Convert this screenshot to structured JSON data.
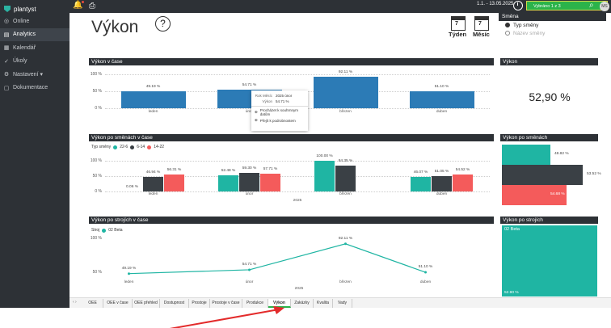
{
  "app": {
    "name": "plantyst"
  },
  "sidebar": {
    "items": [
      {
        "label": "Online",
        "icon": "globe-icon",
        "glyph": "◎",
        "active": false
      },
      {
        "label": "Analytics",
        "icon": "bar-chart-icon",
        "glyph": "▤",
        "active": true
      },
      {
        "label": "Kalendář",
        "icon": "calendar-icon",
        "glyph": "▦",
        "active": false
      },
      {
        "label": "Úkoly",
        "icon": "check-icon",
        "glyph": "✓",
        "active": false
      },
      {
        "label": "Nastavení ▾",
        "icon": "gear-icon",
        "glyph": "⚙",
        "active": false
      },
      {
        "label": "Dokumentace",
        "icon": "document-icon",
        "glyph": "▢",
        "active": false
      }
    ]
  },
  "topbar": {
    "date_range": "1.1. - 13.05.2025",
    "selection": "Vybráno 1 z 3",
    "clear": "✕",
    "avatar": "MS"
  },
  "header": {
    "title": "Výkon",
    "help": "?",
    "week": "Týden",
    "week_num": "7",
    "month": "Měsíc",
    "month_num": "7"
  },
  "shift": {
    "title": "Směna",
    "options": [
      "Typ směny",
      "Název směny"
    ],
    "selected": 0
  },
  "panels": {
    "time": "Výkon v čase",
    "kpi": "Výkon",
    "shifts": "Výkon po směnách v čase",
    "shifts_right": "Výkon po směnách",
    "machines": "Výkon po strojích v čase",
    "machines_right": "Výkon po strojích"
  },
  "kpi_value": "52,90 %",
  "axis_labels": {
    "p100": "100 %",
    "p50": "50 %",
    "p0": "0 %",
    "year": "2025"
  },
  "chart_time": {
    "type": "bar",
    "categories": [
      "leden",
      "únor",
      "březen",
      "duben"
    ],
    "values": [
      49.19,
      54.71,
      92.11,
      51.1
    ],
    "labels": [
      "49.19 %",
      "54.71 %",
      "92.11 %",
      "51.10 %"
    ],
    "ylim": [
      0,
      100
    ],
    "color": "#2c7bb6"
  },
  "tooltip": {
    "k1": "Rok Měsíc",
    "v1": "2025 únor",
    "k2": "Výkon",
    "v2": "54.71 %",
    "a1": "Procházet k souhrnnym datům",
    "a2": "Přejít k podrobnostem"
  },
  "legend_shifts": {
    "title": "Typ směny",
    "items": [
      {
        "label": "22-6",
        "color": "#1fb5a3"
      },
      {
        "label": "6-14",
        "color": "#3a4045"
      },
      {
        "label": "14-22",
        "color": "#f45b5b"
      }
    ]
  },
  "chart_shifts": {
    "type": "bar",
    "categories": [
      "leden",
      "únor",
      "březen",
      "duben"
    ],
    "series": [
      {
        "name": "22-6",
        "color": "#1fb5a3",
        "values": [
          0.06,
          52.48,
          100.0,
          46.07
        ],
        "labels": [
          "0.06 %",
          "52.48 %",
          "100.00 %",
          "46.07 %"
        ]
      },
      {
        "name": "6-14",
        "color": "#3a4045",
        "values": [
          46.94,
          59.3,
          84.35,
          51.05
        ],
        "labels": [
          "46.94 %",
          "59.30 %",
          "84.35 %",
          "51.05 %"
        ]
      },
      {
        "name": "14-22",
        "color": "#f45b5b",
        "values": [
          56.31,
          57.71,
          null,
          54.52
        ],
        "labels": [
          "56.31 %",
          "57.71 %",
          "",
          "54.52 %"
        ]
      }
    ],
    "ylim": [
      0,
      100
    ]
  },
  "shifts_right": [
    {
      "label": "48.82 %",
      "color": "#1fb5a3"
    },
    {
      "label": "53.52 %",
      "color": "#3a4045"
    },
    {
      "label": "54.68 %",
      "color": "#f45b5b"
    }
  ],
  "legend_machines": {
    "title": "Stroj",
    "items": [
      {
        "label": "02 Beta",
        "color": "#1fb5a3"
      }
    ]
  },
  "chart_machines": {
    "type": "line",
    "categories": [
      "leden",
      "únor",
      "březen",
      "duben"
    ],
    "series": [
      {
        "name": "02 Beta",
        "color": "#1fb5a3",
        "values": [
          49.19,
          54.71,
          92.11,
          51.1
        ],
        "labels": [
          "49.19 %",
          "54.71 %",
          "92.11 %",
          "51.10 %"
        ]
      }
    ],
    "ylim": [
      0,
      100
    ]
  },
  "machines_right": {
    "name": "02 Beta",
    "value": "52.90 %",
    "color": "#1fb5a3"
  },
  "tabs": [
    "OEE",
    "OEE v čase",
    "OEE přehled",
    "Dostupnost",
    "Prostoje",
    "Prostoje v čase",
    "Produkce",
    "Výkon",
    "Zakázky",
    "Kvalita",
    "Vady"
  ],
  "active_tab": "Výkon",
  "pager": "‹ ›"
}
